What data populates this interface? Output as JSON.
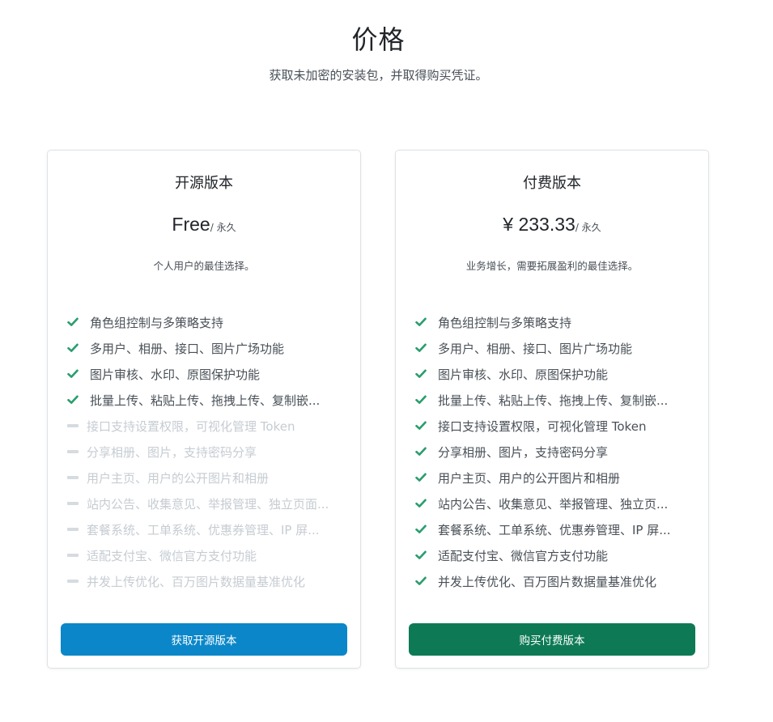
{
  "header": {
    "title": "价格",
    "subtitle": "获取未加密的安装包，并取得购买凭证。"
  },
  "colors": {
    "check": "#2a9d6e",
    "dash": "#d6dbe0",
    "free_button": "#0b87c9",
    "paid_button": "#0d7a55"
  },
  "plans": [
    {
      "name": "开源版本",
      "price": "Free",
      "period": "/ 永久",
      "description": "个人用户的最佳选择。",
      "button_label": "获取开源版本",
      "features": [
        {
          "label": "角色组控制与多策略支持",
          "included": true
        },
        {
          "label": "多用户、相册、接口、图片广场功能",
          "included": true
        },
        {
          "label": "图片审核、水印、原图保护功能",
          "included": true
        },
        {
          "label": "批量上传、粘贴上传、拖拽上传、复制嵌...",
          "included": true
        },
        {
          "label": "接口支持设置权限，可视化管理 Token",
          "included": false
        },
        {
          "label": "分享相册、图片，支持密码分享",
          "included": false
        },
        {
          "label": "用户主页、用户的公开图片和相册",
          "included": false
        },
        {
          "label": "站内公告、收集意见、举报管理、独立页面...",
          "included": false
        },
        {
          "label": "套餐系统、工单系统、优惠券管理、IP 屏...",
          "included": false
        },
        {
          "label": "适配支付宝、微信官方支付功能",
          "included": false
        },
        {
          "label": "并发上传优化、百万图片数据量基准优化",
          "included": false
        }
      ]
    },
    {
      "name": "付费版本",
      "price": "¥ 233.33",
      "period": "/ 永久",
      "description": "业务增长，需要拓展盈利的最佳选择。",
      "button_label": "购买付费版本",
      "features": [
        {
          "label": "角色组控制与多策略支持",
          "included": true
        },
        {
          "label": "多用户、相册、接口、图片广场功能",
          "included": true
        },
        {
          "label": "图片审核、水印、原图保护功能",
          "included": true
        },
        {
          "label": "批量上传、粘贴上传、拖拽上传、复制嵌...",
          "included": true
        },
        {
          "label": "接口支持设置权限，可视化管理 Token",
          "included": true
        },
        {
          "label": "分享相册、图片，支持密码分享",
          "included": true
        },
        {
          "label": "用户主页、用户的公开图片和相册",
          "included": true
        },
        {
          "label": "站内公告、收集意见、举报管理、独立页...",
          "included": true
        },
        {
          "label": "套餐系统、工单系统、优惠券管理、IP 屏...",
          "included": true
        },
        {
          "label": "适配支付宝、微信官方支付功能",
          "included": true
        },
        {
          "label": "并发上传优化、百万图片数据量基准优化",
          "included": true
        }
      ]
    }
  ]
}
